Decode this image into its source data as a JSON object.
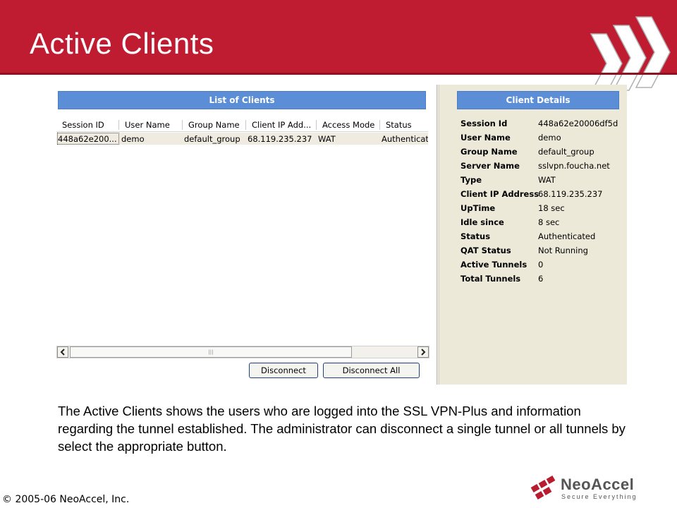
{
  "slide": {
    "title": "Active Clients",
    "description": "The Active Clients shows the users who are logged into the SSL VPN-Plus and information regarding the tunnel established. The administrator can disconnect a single tunnel or all tunnels by select the appropriate button.",
    "copyright": "© 2005-06 NeoAccel, Inc."
  },
  "logo": {
    "name": "NeoAccel",
    "tagline": "Secure Everything"
  },
  "list": {
    "header": "List of Clients",
    "columns": [
      "Session ID",
      "User Name",
      "Group Name",
      "Client IP Add...",
      "Access Mode",
      "Status"
    ],
    "rows": [
      [
        "448a62e200...",
        "demo",
        "default_group",
        "68.119.235.237",
        "WAT",
        "Authenticat"
      ]
    ],
    "buttons": {
      "disconnect": "Disconnect",
      "disconnect_all": "Disconnect All"
    },
    "scroll_thumb_grip": "|||"
  },
  "details": {
    "header": "Client Details",
    "rows": [
      {
        "key": "Session Id",
        "value": "448a62e20006df5d"
      },
      {
        "key": "User Name",
        "value": "demo"
      },
      {
        "key": "Group Name",
        "value": "default_group"
      },
      {
        "key": "Server Name",
        "value": "sslvpn.foucha.net"
      },
      {
        "key": "Type",
        "value": "WAT"
      },
      {
        "key": "Client IP Address",
        "value": "68.119.235.237"
      },
      {
        "key": "UpTime",
        "value": "18 sec"
      },
      {
        "key": "Idle since",
        "value": "8 sec"
      },
      {
        "key": "Status",
        "value": "Authenticated"
      },
      {
        "key": "QAT Status",
        "value": "Not Running"
      },
      {
        "key": "Active Tunnels",
        "value": "0"
      },
      {
        "key": "Total Tunnels",
        "value": "6"
      }
    ]
  },
  "colors": {
    "header_red": "#c01c31",
    "panel_blue": "#5b8ed6",
    "details_bg": "#ece9d8"
  }
}
